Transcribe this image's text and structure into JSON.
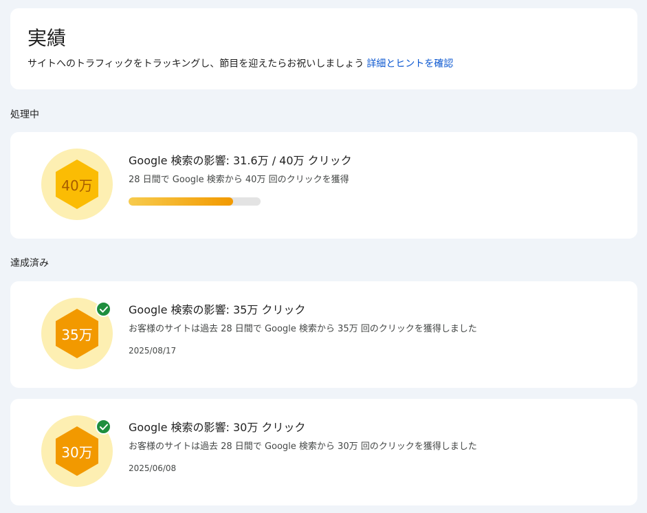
{
  "header": {
    "title": "実績",
    "description": "サイトへのトラフィックをトラッキングし、節目を迎えたらお祝いしましょう",
    "link": "詳細とヒントを確認"
  },
  "sections": {
    "in_progress": "処理中",
    "achieved": "達成済み"
  },
  "in_progress_card": {
    "badge": "40万",
    "title": "Google 検索の影響: 31.6万 / 40万 クリック",
    "description": "28 日間で Google 検索から 40万 回のクリックを獲得",
    "progress": 0.79
  },
  "achieved_cards": [
    {
      "badge": "35万",
      "title": "Google 検索の影響: 35万 クリック",
      "description": "お客様のサイトは過去 28 日間で Google 検索から 35万 回のクリックを獲得しました",
      "date": "2025/08/17"
    },
    {
      "badge": "30万",
      "title": "Google 検索の影響: 30万 クリック",
      "description": "お客様のサイトは過去 28 日間で Google 検索から 30万 回のクリックを獲得しました",
      "date": "2025/06/08"
    }
  ],
  "icons": {
    "badge": "hexagon-badge-icon",
    "achieved": "check-circle-icon"
  },
  "colors": {
    "link": "#0b57d0",
    "check": "#1e8e3e",
    "badge_bg": "#fdefb2",
    "hex_progress": "#fbbc04",
    "hex_done": "#f29900"
  }
}
